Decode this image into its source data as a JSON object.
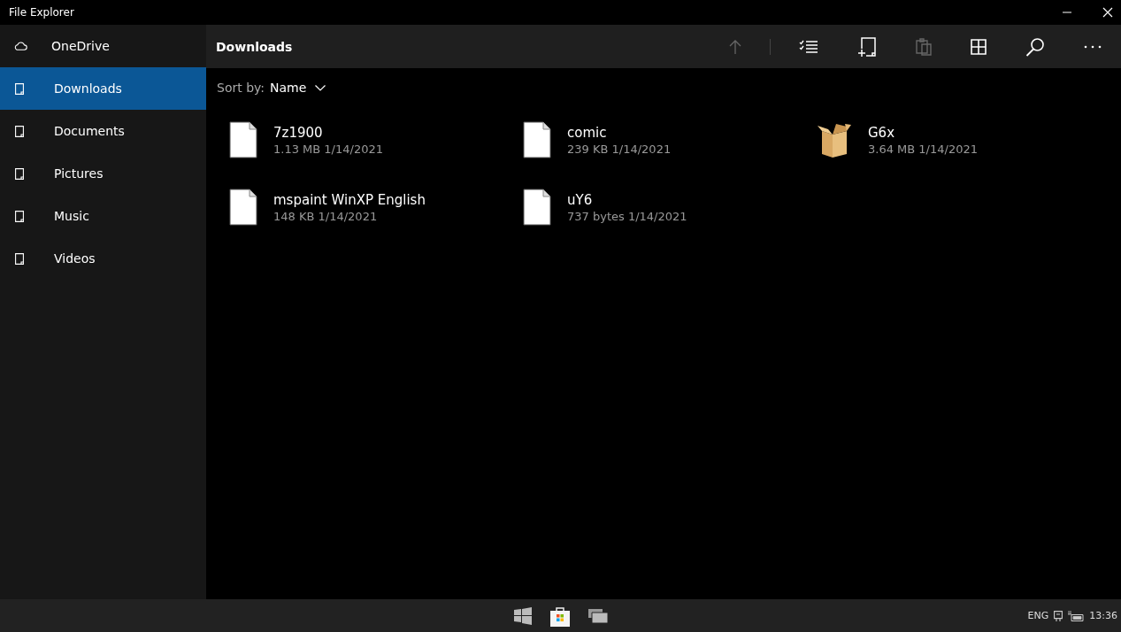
{
  "window": {
    "title": "File Explorer"
  },
  "sidebar": {
    "items": [
      {
        "label": "OneDrive",
        "kind": "cloud",
        "selected": false
      },
      {
        "label": "Downloads",
        "kind": "folder",
        "selected": true
      },
      {
        "label": "Documents",
        "kind": "folder",
        "selected": false
      },
      {
        "label": "Pictures",
        "kind": "folder",
        "selected": false
      },
      {
        "label": "Music",
        "kind": "folder",
        "selected": false
      },
      {
        "label": "Videos",
        "kind": "folder",
        "selected": false
      }
    ]
  },
  "header": {
    "title": "Downloads",
    "toolbar": [
      {
        "kind": "up",
        "disabled": true
      },
      {
        "kind": "select",
        "disabled": false
      },
      {
        "kind": "new",
        "disabled": false
      },
      {
        "kind": "paste",
        "disabled": true
      },
      {
        "kind": "view",
        "disabled": false
      },
      {
        "kind": "search",
        "disabled": false
      },
      {
        "kind": "more",
        "disabled": false
      }
    ]
  },
  "sort": {
    "label": "Sort by:",
    "value": "Name"
  },
  "files": [
    {
      "name": "7z1900",
      "detail": "1.13 MB 1/14/2021",
      "kind": "file"
    },
    {
      "name": "comic",
      "detail": "239 KB 1/14/2021",
      "kind": "file"
    },
    {
      "name": "G6x",
      "detail": "3.64 MB 1/14/2021",
      "kind": "package"
    },
    {
      "name": "mspaint WinXP English",
      "detail": "148 KB 1/14/2021",
      "kind": "file"
    },
    {
      "name": "uY6",
      "detail": "737 bytes 1/14/2021",
      "kind": "file"
    }
  ],
  "taskbar": {
    "language": "ENG",
    "time": "13:36"
  }
}
